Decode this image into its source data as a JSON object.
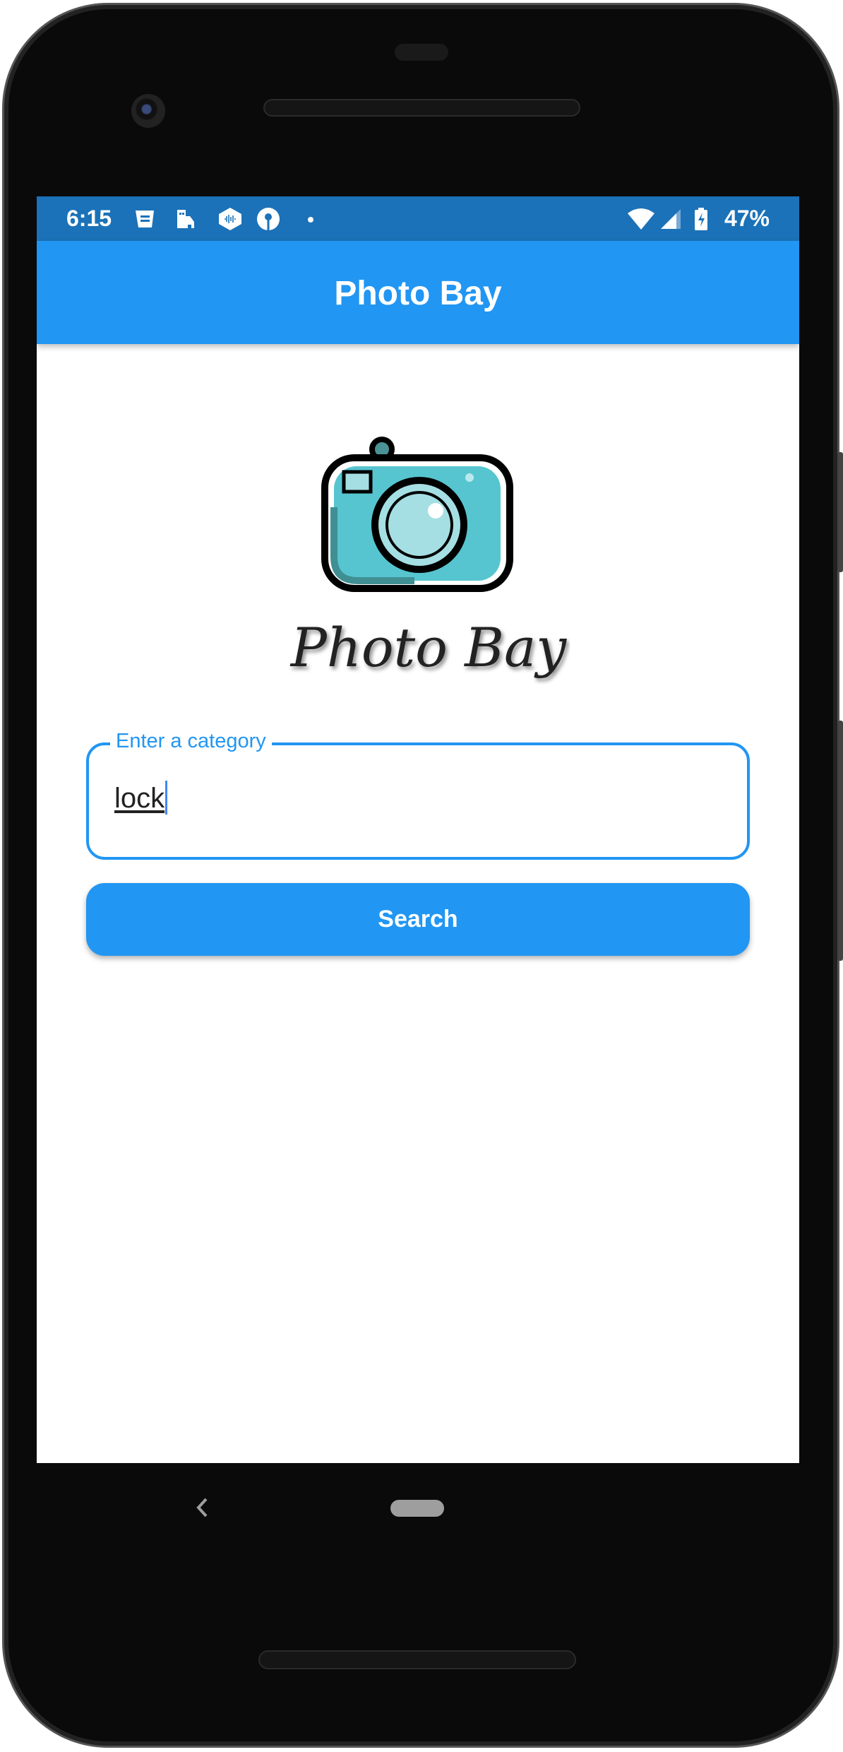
{
  "status_bar": {
    "time": "6:15",
    "battery": "47%",
    "icons": [
      "news-icon",
      "building-icon",
      "sound-hex-icon",
      "sbi-icon",
      "dot-icon",
      "wifi-icon",
      "signal-icon",
      "battery-charging-icon"
    ]
  },
  "app_bar": {
    "title": "Photo Bay"
  },
  "logo": {
    "text": "Photo Bay"
  },
  "form": {
    "category_label": "Enter a category",
    "category_value": "lock",
    "search_label": "Search"
  },
  "colors": {
    "primary": "#2196F3",
    "status": "#1b72b8",
    "logo_teal": "#56c5d0"
  }
}
